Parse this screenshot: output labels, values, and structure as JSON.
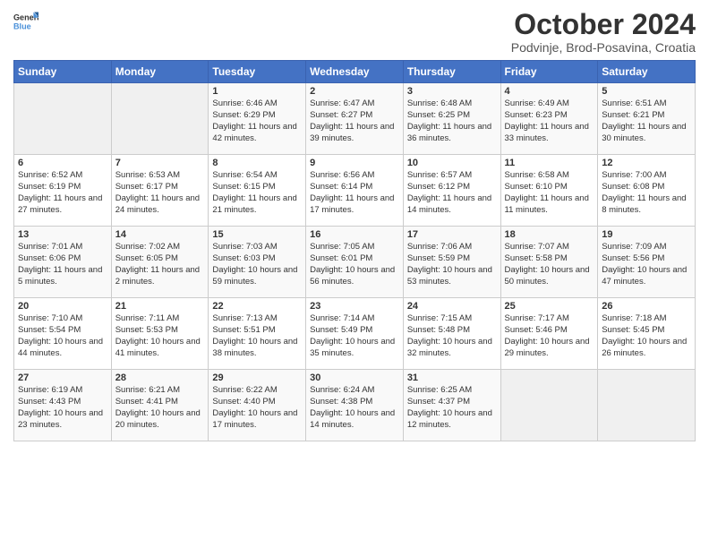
{
  "header": {
    "logo_general": "General",
    "logo_blue": "Blue",
    "title": "October 2024",
    "subtitle": "Podvinje, Brod-Posavina, Croatia"
  },
  "days_of_week": [
    "Sunday",
    "Monday",
    "Tuesday",
    "Wednesday",
    "Thursday",
    "Friday",
    "Saturday"
  ],
  "weeks": [
    [
      {
        "day": "",
        "info": ""
      },
      {
        "day": "",
        "info": ""
      },
      {
        "day": "1",
        "info": "Sunrise: 6:46 AM\nSunset: 6:29 PM\nDaylight: 11 hours and 42 minutes."
      },
      {
        "day": "2",
        "info": "Sunrise: 6:47 AM\nSunset: 6:27 PM\nDaylight: 11 hours and 39 minutes."
      },
      {
        "day": "3",
        "info": "Sunrise: 6:48 AM\nSunset: 6:25 PM\nDaylight: 11 hours and 36 minutes."
      },
      {
        "day": "4",
        "info": "Sunrise: 6:49 AM\nSunset: 6:23 PM\nDaylight: 11 hours and 33 minutes."
      },
      {
        "day": "5",
        "info": "Sunrise: 6:51 AM\nSunset: 6:21 PM\nDaylight: 11 hours and 30 minutes."
      }
    ],
    [
      {
        "day": "6",
        "info": "Sunrise: 6:52 AM\nSunset: 6:19 PM\nDaylight: 11 hours and 27 minutes."
      },
      {
        "day": "7",
        "info": "Sunrise: 6:53 AM\nSunset: 6:17 PM\nDaylight: 11 hours and 24 minutes."
      },
      {
        "day": "8",
        "info": "Sunrise: 6:54 AM\nSunset: 6:15 PM\nDaylight: 11 hours and 21 minutes."
      },
      {
        "day": "9",
        "info": "Sunrise: 6:56 AM\nSunset: 6:14 PM\nDaylight: 11 hours and 17 minutes."
      },
      {
        "day": "10",
        "info": "Sunrise: 6:57 AM\nSunset: 6:12 PM\nDaylight: 11 hours and 14 minutes."
      },
      {
        "day": "11",
        "info": "Sunrise: 6:58 AM\nSunset: 6:10 PM\nDaylight: 11 hours and 11 minutes."
      },
      {
        "day": "12",
        "info": "Sunrise: 7:00 AM\nSunset: 6:08 PM\nDaylight: 11 hours and 8 minutes."
      }
    ],
    [
      {
        "day": "13",
        "info": "Sunrise: 7:01 AM\nSunset: 6:06 PM\nDaylight: 11 hours and 5 minutes."
      },
      {
        "day": "14",
        "info": "Sunrise: 7:02 AM\nSunset: 6:05 PM\nDaylight: 11 hours and 2 minutes."
      },
      {
        "day": "15",
        "info": "Sunrise: 7:03 AM\nSunset: 6:03 PM\nDaylight: 10 hours and 59 minutes."
      },
      {
        "day": "16",
        "info": "Sunrise: 7:05 AM\nSunset: 6:01 PM\nDaylight: 10 hours and 56 minutes."
      },
      {
        "day": "17",
        "info": "Sunrise: 7:06 AM\nSunset: 5:59 PM\nDaylight: 10 hours and 53 minutes."
      },
      {
        "day": "18",
        "info": "Sunrise: 7:07 AM\nSunset: 5:58 PM\nDaylight: 10 hours and 50 minutes."
      },
      {
        "day": "19",
        "info": "Sunrise: 7:09 AM\nSunset: 5:56 PM\nDaylight: 10 hours and 47 minutes."
      }
    ],
    [
      {
        "day": "20",
        "info": "Sunrise: 7:10 AM\nSunset: 5:54 PM\nDaylight: 10 hours and 44 minutes."
      },
      {
        "day": "21",
        "info": "Sunrise: 7:11 AM\nSunset: 5:53 PM\nDaylight: 10 hours and 41 minutes."
      },
      {
        "day": "22",
        "info": "Sunrise: 7:13 AM\nSunset: 5:51 PM\nDaylight: 10 hours and 38 minutes."
      },
      {
        "day": "23",
        "info": "Sunrise: 7:14 AM\nSunset: 5:49 PM\nDaylight: 10 hours and 35 minutes."
      },
      {
        "day": "24",
        "info": "Sunrise: 7:15 AM\nSunset: 5:48 PM\nDaylight: 10 hours and 32 minutes."
      },
      {
        "day": "25",
        "info": "Sunrise: 7:17 AM\nSunset: 5:46 PM\nDaylight: 10 hours and 29 minutes."
      },
      {
        "day": "26",
        "info": "Sunrise: 7:18 AM\nSunset: 5:45 PM\nDaylight: 10 hours and 26 minutes."
      }
    ],
    [
      {
        "day": "27",
        "info": "Sunrise: 6:19 AM\nSunset: 4:43 PM\nDaylight: 10 hours and 23 minutes."
      },
      {
        "day": "28",
        "info": "Sunrise: 6:21 AM\nSunset: 4:41 PM\nDaylight: 10 hours and 20 minutes."
      },
      {
        "day": "29",
        "info": "Sunrise: 6:22 AM\nSunset: 4:40 PM\nDaylight: 10 hours and 17 minutes."
      },
      {
        "day": "30",
        "info": "Sunrise: 6:24 AM\nSunset: 4:38 PM\nDaylight: 10 hours and 14 minutes."
      },
      {
        "day": "31",
        "info": "Sunrise: 6:25 AM\nSunset: 4:37 PM\nDaylight: 10 hours and 12 minutes."
      },
      {
        "day": "",
        "info": ""
      },
      {
        "day": "",
        "info": ""
      }
    ]
  ]
}
